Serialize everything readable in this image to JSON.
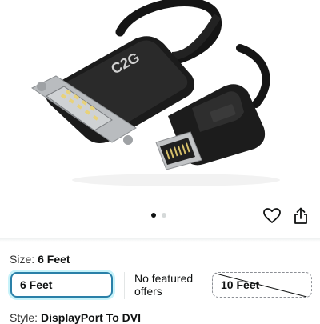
{
  "product": {
    "brand_logo": "C2G"
  },
  "carousel": {
    "count": 2,
    "active": 1
  },
  "actions": {
    "wishlist_icon": "heart-icon",
    "share_icon": "share-icon"
  },
  "size": {
    "label": "Size:",
    "selected_value": "6 Feet",
    "options": [
      {
        "label": "6 Feet",
        "state": "selected"
      },
      {
        "label": "No featured offers",
        "line1": "No featured",
        "line2": "offers",
        "state": "info"
      },
      {
        "label": "10 Feet",
        "state": "unavailable"
      }
    ]
  },
  "style": {
    "label": "Style:",
    "value": "DisplayPort To DVI"
  },
  "colors": {
    "accent": "#2a80a8",
    "accent_glow": "#c8f3fa",
    "text": "#0f1111"
  }
}
